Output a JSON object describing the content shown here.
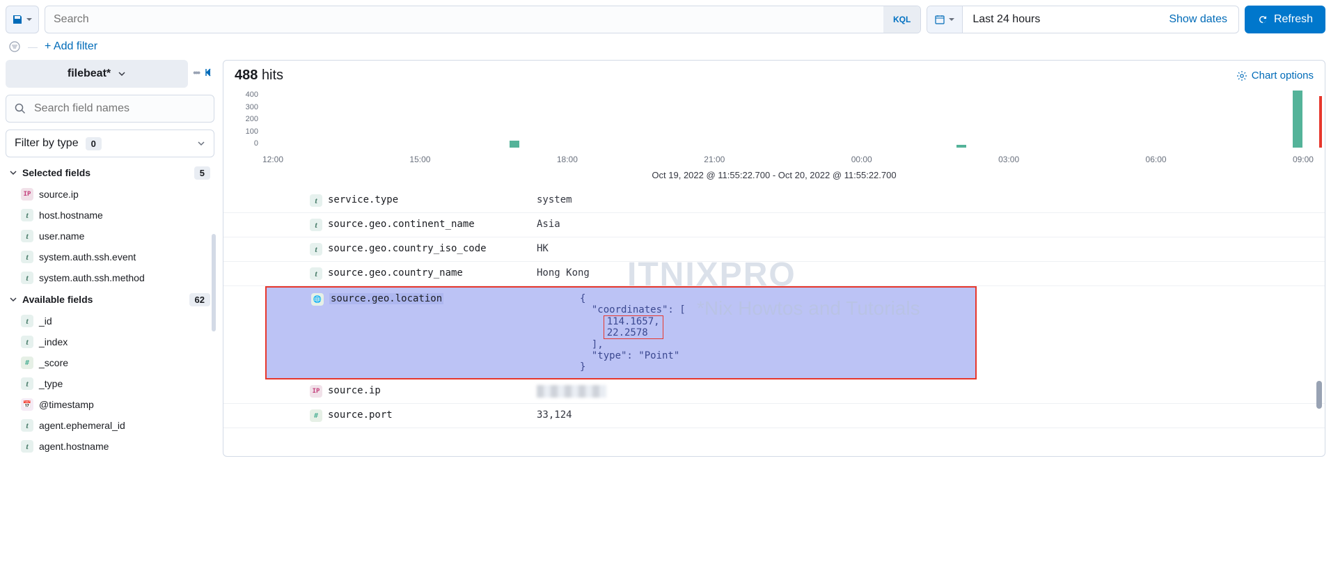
{
  "toolbar": {
    "search_placeholder": "Search",
    "kql": "KQL",
    "date_text": "Last 24 hours",
    "show_dates": "Show dates",
    "refresh": "Refresh",
    "add_filter": "+ Add filter"
  },
  "sidebar": {
    "index_pattern": "filebeat*",
    "field_search_placeholder": "Search field names",
    "filter_by_type": "Filter by type",
    "filter_count": "0",
    "selected_label": "Selected fields",
    "selected_count": "5",
    "available_label": "Available fields",
    "available_count": "62",
    "selected_fields": [
      {
        "type": "ip",
        "name": "source.ip"
      },
      {
        "type": "t",
        "name": "host.hostname"
      },
      {
        "type": "t",
        "name": "user.name"
      },
      {
        "type": "t",
        "name": "system.auth.ssh.event"
      },
      {
        "type": "t",
        "name": "system.auth.ssh.method"
      }
    ],
    "available_fields": [
      {
        "type": "t",
        "name": "_id"
      },
      {
        "type": "t",
        "name": "_index"
      },
      {
        "type": "hash",
        "name": "_score"
      },
      {
        "type": "t",
        "name": "_type"
      },
      {
        "type": "date",
        "name": "@timestamp"
      },
      {
        "type": "t",
        "name": "agent.ephemeral_id"
      },
      {
        "type": "t",
        "name": "agent.hostname"
      }
    ]
  },
  "content": {
    "hits_count": "488",
    "hits_label": "hits",
    "chart_options": "Chart options",
    "time_range": "Oct 19, 2022 @ 11:55:22.700 - Oct 20, 2022 @ 11:55:22.700"
  },
  "chart_data": {
    "type": "bar",
    "y_ticks": [
      "400",
      "300",
      "200",
      "100",
      "0"
    ],
    "x_ticks": [
      "12:00",
      "15:00",
      "18:00",
      "21:00",
      "00:00",
      "03:00",
      "06:00",
      "09:00"
    ],
    "bars": [
      {
        "x_pct": 23.5,
        "height_pct": 12
      },
      {
        "x_pct": 66.0,
        "height_pct": 5
      },
      {
        "x_pct": 98.0,
        "height_pct": 100
      }
    ],
    "highlight_bar": {
      "x_pct": 100.5,
      "height_pct": 90
    },
    "ylim": [
      0,
      400
    ]
  },
  "doc": {
    "rows": [
      {
        "type": "t",
        "name": "service.type",
        "value": "system"
      },
      {
        "type": "t",
        "name": "source.geo.continent_name",
        "value": "Asia"
      },
      {
        "type": "t",
        "name": "source.geo.country_iso_code",
        "value": "HK"
      },
      {
        "type": "t",
        "name": "source.geo.country_name",
        "value": "Hong Kong"
      }
    ],
    "location": {
      "name": "source.geo.location",
      "coords_label": "\"coordinates\"",
      "lon": "114.1657",
      "lat": "22.2578",
      "type_line": "\"type\": \"Point\""
    },
    "source_ip": {
      "name": "source.ip"
    },
    "source_port": {
      "name": "source.port",
      "value": "33,124"
    }
  },
  "watermark": {
    "title": "ITNIXPRO",
    "subtitle": "*Nix Howtos and Tutorials"
  }
}
